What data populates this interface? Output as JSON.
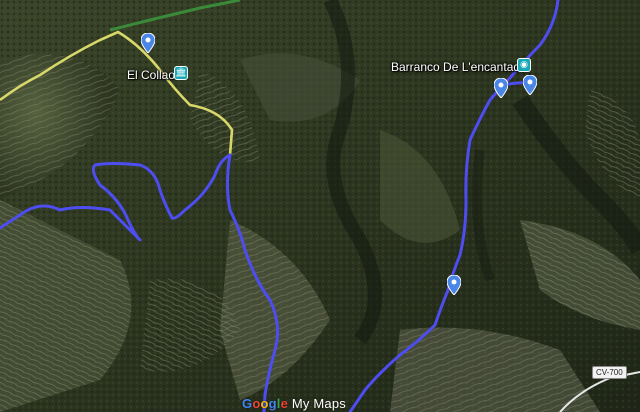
{
  "map": {
    "type": "satellite",
    "route_color": "#4d4df0",
    "road_yellow": "#d8d86a",
    "road_green": "#3a8a3a",
    "pin_color": "#4a86e8"
  },
  "places": {
    "el_collao": {
      "label": "El Collao",
      "icon": "museum-icon"
    },
    "barranco": {
      "label": "Barranco De L'encantada",
      "icon": "viewpoint-icon"
    }
  },
  "road_badge": {
    "label": "CV-700"
  },
  "watermark": {
    "g": "G",
    "o1": "o",
    "o2": "o",
    "g2": "g",
    "l": "l",
    "e": "e",
    "my_maps": " My Maps"
  }
}
